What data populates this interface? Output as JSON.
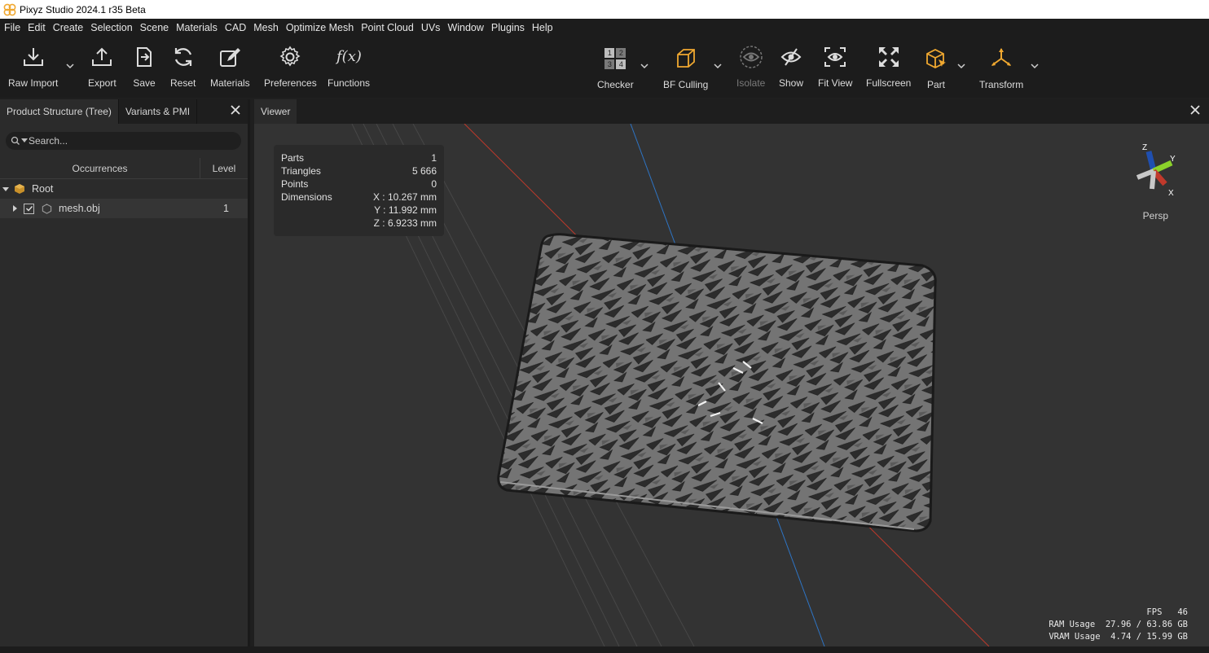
{
  "app": {
    "title": "Pixyz Studio 2024.1 r35 Beta"
  },
  "menu": [
    "File",
    "Edit",
    "Create",
    "Selection",
    "Scene",
    "Materials",
    "CAD",
    "Mesh",
    "Optimize Mesh",
    "Point Cloud",
    "UVs",
    "Window",
    "Plugins",
    "Help"
  ],
  "toolbar": {
    "raw_import": "Raw Import",
    "export": "Export",
    "save": "Save",
    "reset": "Reset",
    "materials": "Materials",
    "preferences": "Preferences",
    "functions": "Functions",
    "checker": "Checker",
    "bf_culling": "BF Culling",
    "isolate": "Isolate",
    "show": "Show",
    "fit_view": "Fit View",
    "fullscreen": "Fullscreen",
    "part": "Part",
    "transform": "Transform",
    "functions_glyph": "f(x)",
    "checker_glyph": [
      "1",
      "2",
      "3",
      "4"
    ]
  },
  "panel": {
    "tabs": [
      "Product Structure (Tree)",
      "Variants & PMI"
    ],
    "search_placeholder": "Search...",
    "columns": {
      "occurrences": "Occurrences",
      "level": "Level"
    },
    "tree": [
      {
        "name": "Root",
        "level": ""
      },
      {
        "name": "mesh.obj",
        "level": "1"
      }
    ]
  },
  "viewer": {
    "tab": "Viewer",
    "stats": {
      "parts_label": "Parts",
      "parts_value": "1",
      "triangles_label": "Triangles",
      "triangles_value": "5 666",
      "points_label": "Points",
      "points_value": "0",
      "dimensions_label": "Dimensions",
      "dim_x": "X : 10.267 mm",
      "dim_y": "Y : 11.992 mm",
      "dim_z": "Z : 6.9233 mm"
    },
    "camera_mode": "Persp",
    "gizmo": {
      "z": "Z",
      "y": "Y",
      "x": "X"
    },
    "perf": {
      "fps": "FPS   46",
      "ram": "RAM Usage  27.96 / 63.86 GB",
      "vram": "VRAM Usage  4.74 / 15.99 GB"
    }
  },
  "colors": {
    "accent": "#f0a830",
    "axis_red": "#c0392b",
    "axis_blue": "#2e74c4"
  }
}
